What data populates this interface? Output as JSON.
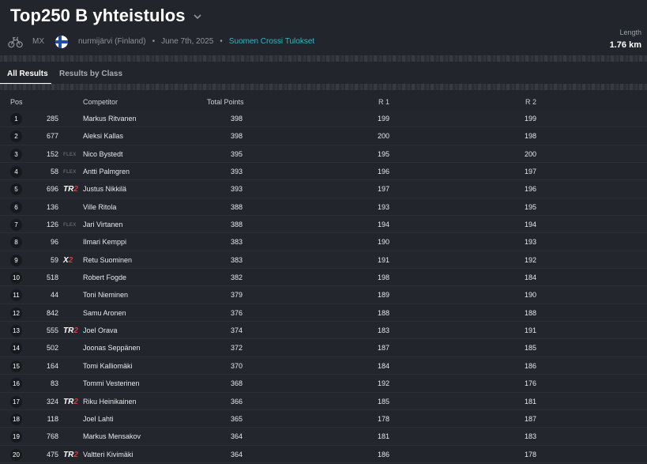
{
  "event": {
    "title": "Top250 B yhteistulos",
    "sport": "MX",
    "location": "nurmijärvi (Finland)",
    "date": "June 7th, 2025",
    "series": "Suomen Crossi Tulokset",
    "length_label": "Length",
    "length_value": "1.76 km"
  },
  "tabs": [
    {
      "label": "All Results",
      "active": true
    },
    {
      "label": "Results by Class",
      "active": false
    }
  ],
  "columns": {
    "pos": "Pos",
    "competitor": "Competitor",
    "total": "Total Points",
    "r1": "R 1",
    "r2": "R 2"
  },
  "rows": [
    {
      "pos": "1",
      "num": "285",
      "tag": "",
      "name": "Markus Ritvanen",
      "total": "398",
      "r1": "199",
      "r2": "199"
    },
    {
      "pos": "2",
      "num": "677",
      "tag": "",
      "name": "Aleksi Kallas",
      "total": "398",
      "r1": "200",
      "r2": "198"
    },
    {
      "pos": "3",
      "num": "152",
      "tag": "FLEX",
      "name": "Nico Bystedt",
      "total": "395",
      "r1": "195",
      "r2": "200"
    },
    {
      "pos": "4",
      "num": "58",
      "tag": "FLEX",
      "name": "Antti Palmgren",
      "total": "393",
      "r1": "196",
      "r2": "197"
    },
    {
      "pos": "5",
      "num": "696",
      "tag": "TR2",
      "name": "Justus Nikkilä",
      "total": "393",
      "r1": "197",
      "r2": "196"
    },
    {
      "pos": "6",
      "num": "136",
      "tag": "",
      "name": "Ville Ritola",
      "total": "388",
      "r1": "193",
      "r2": "195"
    },
    {
      "pos": "7",
      "num": "126",
      "tag": "FLEX",
      "name": "Jari Virtanen",
      "total": "388",
      "r1": "194",
      "r2": "194"
    },
    {
      "pos": "8",
      "num": "96",
      "tag": "",
      "name": "Ilmari Kemppi",
      "total": "383",
      "r1": "190",
      "r2": "193"
    },
    {
      "pos": "9",
      "num": "59",
      "tag": "X2",
      "name": "Retu Suominen",
      "total": "383",
      "r1": "191",
      "r2": "192"
    },
    {
      "pos": "10",
      "num": "518",
      "tag": "",
      "name": "Robert Fogde",
      "total": "382",
      "r1": "198",
      "r2": "184"
    },
    {
      "pos": "11",
      "num": "44",
      "tag": "",
      "name": "Toni Nieminen",
      "total": "379",
      "r1": "189",
      "r2": "190"
    },
    {
      "pos": "12",
      "num": "842",
      "tag": "",
      "name": "Samu Aronen",
      "total": "376",
      "r1": "188",
      "r2": "188"
    },
    {
      "pos": "13",
      "num": "555",
      "tag": "TR2",
      "name": "Joel Orava",
      "total": "374",
      "r1": "183",
      "r2": "191"
    },
    {
      "pos": "14",
      "num": "502",
      "tag": "",
      "name": "Joonas Seppänen",
      "total": "372",
      "r1": "187",
      "r2": "185"
    },
    {
      "pos": "15",
      "num": "164",
      "tag": "",
      "name": "Tomi Kalliomäki",
      "total": "370",
      "r1": "184",
      "r2": "186"
    },
    {
      "pos": "16",
      "num": "83",
      "tag": "",
      "name": "Tommi Vesterinen",
      "total": "368",
      "r1": "192",
      "r2": "176"
    },
    {
      "pos": "17",
      "num": "324",
      "tag": "TR2",
      "name": "Riku Heinikainen",
      "total": "366",
      "r1": "185",
      "r2": "181"
    },
    {
      "pos": "18",
      "num": "118",
      "tag": "",
      "name": "Joel Lahti",
      "total": "365",
      "r1": "178",
      "r2": "187"
    },
    {
      "pos": "19",
      "num": "768",
      "tag": "",
      "name": "Markus Mensakov",
      "total": "364",
      "r1": "181",
      "r2": "183"
    },
    {
      "pos": "20",
      "num": "475",
      "tag": "TR2",
      "name": "Valtteri Kivimäki",
      "total": "364",
      "r1": "186",
      "r2": "178"
    }
  ]
}
